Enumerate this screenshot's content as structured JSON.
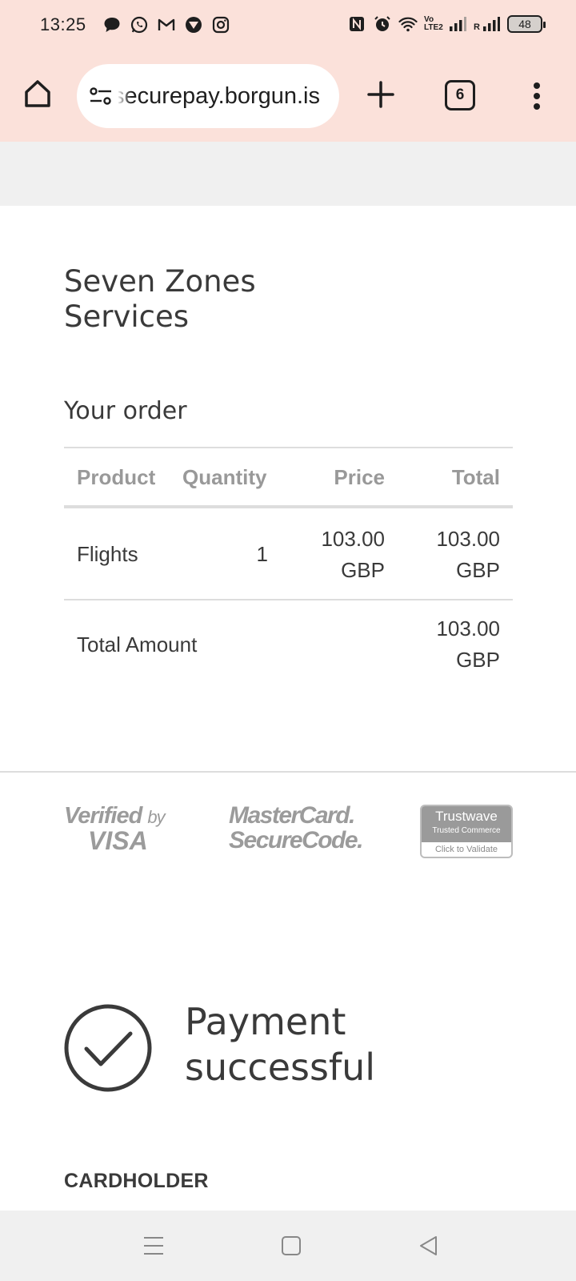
{
  "status_bar": {
    "time": "13:25",
    "battery": "48",
    "left_icons": [
      "chat-bubble-icon",
      "whatsapp-icon",
      "gmail-icon",
      "vpn-icon",
      "instagram-icon"
    ],
    "right_icons": [
      "nfc-icon",
      "alarm-icon",
      "wifi-icon",
      "volte-icon",
      "signal-icon",
      "signal-roaming-icon",
      "battery-icon"
    ],
    "volte_label": "Vo LTE2",
    "roaming_label": "R"
  },
  "browser": {
    "url": "securepay.borgun.is",
    "tab_count": "6"
  },
  "merchant": {
    "name": "Seven Zones Services"
  },
  "order": {
    "heading": "Your order",
    "columns": {
      "product": "Product",
      "quantity": "Quantity",
      "price": "Price",
      "total": "Total"
    },
    "items": [
      {
        "product": "Flights",
        "quantity": "1",
        "price_amount": "103.00",
        "price_currency": "GBP",
        "total_amount": "103.00",
        "total_currency": "GBP"
      }
    ],
    "total_label": "Total Amount",
    "total_amount": "103.00",
    "total_currency": "GBP"
  },
  "badges": {
    "visa_line1": "Verified",
    "visa_by": "by",
    "visa_line2": "VISA",
    "mastercard_line1": "MasterCard.",
    "mastercard_line2": "SecureCode.",
    "trustwave_brand": "Trustwave",
    "trustwave_sub": "Trusted Commerce",
    "trustwave_cta": "Click to Validate"
  },
  "payment": {
    "status": "Payment successful"
  },
  "cardholder": {
    "label": "CARDHOLDER"
  },
  "colors": {
    "chrome_bg": "#fbe1da",
    "page_bg": "#ffffff",
    "muted_gray": "#999999",
    "text": "#3a3a3a"
  }
}
